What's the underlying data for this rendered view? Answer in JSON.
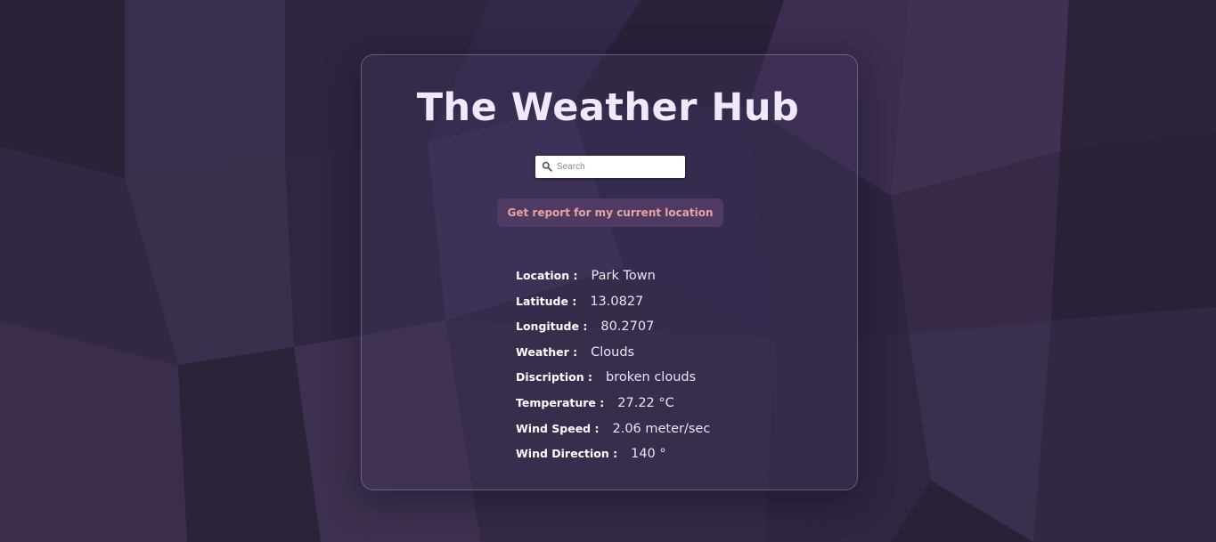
{
  "app": {
    "title": "The Weather Hub"
  },
  "search": {
    "placeholder": "Search",
    "value": "",
    "icon": "search-icon"
  },
  "actions": {
    "current_location_label": "Get report for my current location"
  },
  "report": {
    "rows": [
      {
        "label": "Location :",
        "value": "Park Town"
      },
      {
        "label": "Latitude :",
        "value": "13.0827"
      },
      {
        "label": "Longitude :",
        "value": "80.2707"
      },
      {
        "label": "Weather :",
        "value": "Clouds"
      },
      {
        "label": "Discription :",
        "value": "broken clouds"
      },
      {
        "label": "Temperature :",
        "value": "27.22 °C"
      },
      {
        "label": "Wind Speed :",
        "value": "2.06 meter/sec"
      },
      {
        "label": "Wind Direction :",
        "value": "140 °"
      }
    ]
  },
  "colors": {
    "background": "#2f2640",
    "title": "#f1e9fb",
    "button_bg": "#4e3a63",
    "button_text": "#e6a3a0"
  }
}
